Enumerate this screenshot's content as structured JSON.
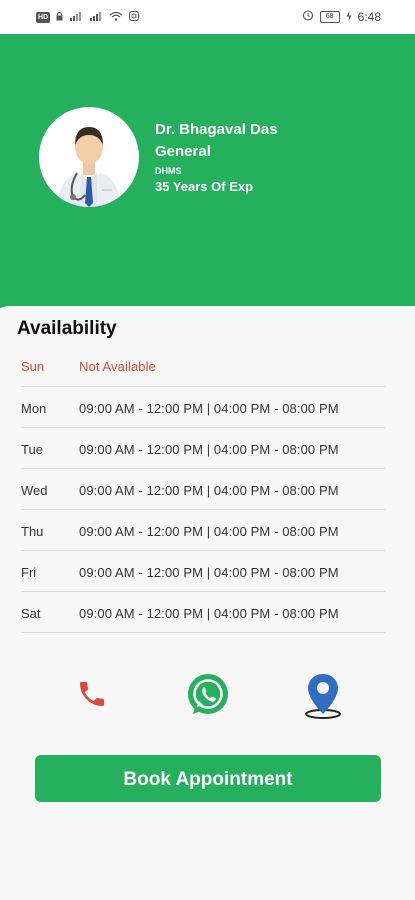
{
  "status_bar": {
    "left_hd": "HD",
    "right_battery": "68",
    "time": "6:48"
  },
  "colors": {
    "brand_green": "#25b05d",
    "closed_red": "#e0463a",
    "pin_blue": "#2f6ec1"
  },
  "doctor": {
    "name": "Dr. Bhagaval Das",
    "specialty": "General",
    "degree": "DHMS",
    "experience": "35 Years Of Exp"
  },
  "availability": {
    "title": "Availability",
    "rows": [
      {
        "day": "Sun",
        "hours": "Not Available"
      },
      {
        "day": "Mon",
        "hours": "09:00 AM - 12:00 PM  |  04:00 PM - 08:00 PM"
      },
      {
        "day": "Tue",
        "hours": "09:00 AM - 12:00 PM  |  04:00 PM - 08:00 PM"
      },
      {
        "day": "Wed",
        "hours": "09:00 AM - 12:00 PM  |  04:00 PM - 08:00 PM"
      },
      {
        "day": "Thu",
        "hours": "09:00 AM - 12:00 PM  |  04:00 PM - 08:00 PM"
      },
      {
        "day": "Fri",
        "hours": "09:00 AM - 12:00 PM  |  04:00 PM - 08:00 PM"
      },
      {
        "day": "Sat",
        "hours": "09:00 AM - 12:00 PM  |  04:00 PM - 08:00 PM"
      }
    ]
  },
  "contact_icons": [
    "phone-icon",
    "whatsapp-icon",
    "location-pin-icon"
  ],
  "book_button": {
    "label": "Book Appointment"
  }
}
